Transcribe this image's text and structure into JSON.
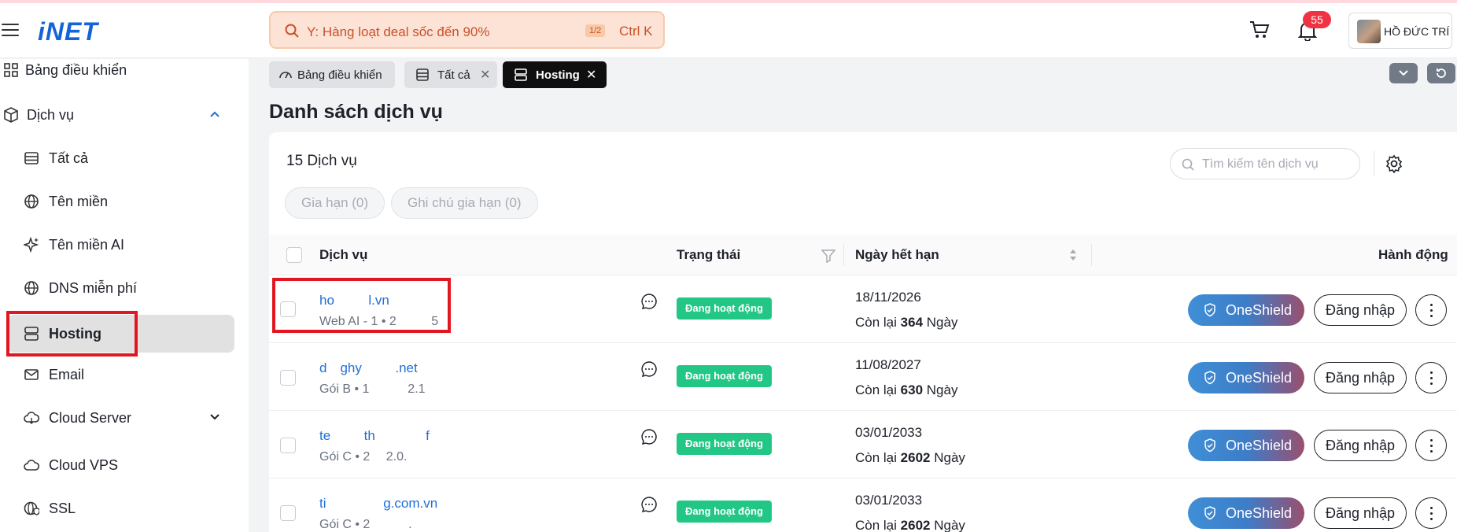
{
  "header": {
    "brand": "iNET",
    "search_placeholder": "Y: Hàng loạt deal sốc đến 90%",
    "search_badge": "1/2",
    "search_shortcut": "Ctrl K",
    "notifications_count": "55",
    "user_name": "HỒ ĐỨC TRÍ"
  },
  "sidebar": {
    "items": [
      {
        "label": "Bảng điều khiển",
        "icon": "dashboard-icon"
      },
      {
        "label": "Dịch vụ",
        "icon": "box-icon"
      },
      {
        "label": "Tất cả",
        "icon": "list-icon"
      },
      {
        "label": "Tên miền",
        "icon": "globe-icon"
      },
      {
        "label": "Tên miền AI",
        "icon": "sparkle-icon"
      },
      {
        "label": "DNS miễn phí",
        "icon": "globe-icon"
      },
      {
        "label": "Hosting",
        "icon": "server-icon"
      },
      {
        "label": "Email",
        "icon": "mail-icon"
      },
      {
        "label": "Cloud Server",
        "icon": "cloud-icon"
      },
      {
        "label": "Cloud VPS",
        "icon": "cloud-icon"
      },
      {
        "label": "SSL",
        "icon": "shield-globe-icon"
      }
    ]
  },
  "tabs": [
    {
      "label": "Bảng điều khiển"
    },
    {
      "label": "Tất cả"
    },
    {
      "label": "Hosting"
    }
  ],
  "page": {
    "title": "Danh sách dịch vụ",
    "count": "15 Dịch vụ",
    "search_placeholder": "Tìm kiếm tên dịch vụ",
    "filter_renew": "Gia hạn (0)",
    "filter_renew_note": "Ghi chú gia hạn (0)"
  },
  "table": {
    "columns": [
      "Dịch vụ",
      "Trạng thái",
      "Ngày hết hạn",
      "Hành động"
    ],
    "remain_prefix": "Còn lại",
    "remain_suffix": "Ngày",
    "rows": [
      {
        "name": "ho      l.vn",
        "sub": "Web AI - 1 • 2      5",
        "status": "Đang hoạt động",
        "date": "18/11/2026",
        "days": "364"
      },
      {
        "name": "d  ghy     .net",
        "sub": "Gói B • 1       2.1",
        "status": "Đang hoạt động",
        "date": "11/08/2027",
        "days": "630"
      },
      {
        "name": "te     th        f",
        "sub": "Gói C • 2   2.0. ",
        "status": "Đang hoạt động",
        "date": "03/01/2033",
        "days": "2602"
      },
      {
        "name": "ti         g.com.vn",
        "sub": "Gói C • 2       .  ",
        "status": "Đang hoạt động",
        "date": "03/01/2033",
        "days": "2602"
      }
    ],
    "action_shield": "OneShield",
    "action_login": "Đăng nhập"
  },
  "colors": {
    "brand": "#1463d8",
    "status_active": "#22c785",
    "highlight": "#e3161f"
  }
}
